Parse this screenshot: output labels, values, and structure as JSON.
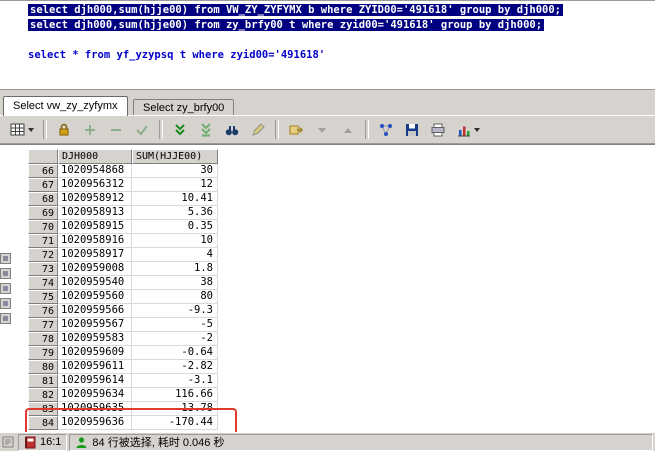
{
  "editor": {
    "lines": [
      {
        "text": "select djh000,sum(hjje00) from VW_ZY_ZYFYMX b where ZYID00='491618' group by djh000;",
        "selected": true
      },
      {
        "text": "select djh000,sum(hjje00) from zy_brfy00 t where zyid00='491618' group by djh000;",
        "selected": true
      },
      {
        "text": "select * from yf_yzypsq t where zyid00='491618'",
        "selected": false
      }
    ]
  },
  "tabs": [
    {
      "label": "Select vw_zy_zyfymx",
      "active": true
    },
    {
      "label": "Select zy_brfy00",
      "active": false
    }
  ],
  "toolbar": {
    "icons": [
      "result-grid-view",
      "lock",
      "insert-record",
      "delete-record",
      "post-changes",
      "fetch-next-page",
      "fetch-all",
      "find",
      "edit-data",
      "export-data",
      "sort-descending",
      "sort-ascending",
      "linked-query",
      "save-results",
      "print-results",
      "chart"
    ]
  },
  "grid": {
    "columns": [
      "DJH000",
      "SUM(HJJE00)"
    ],
    "rows": [
      [
        66,
        "1020954868",
        "30"
      ],
      [
        67,
        "1020956312",
        "12"
      ],
      [
        68,
        "1020958912",
        "10.41"
      ],
      [
        69,
        "1020958913",
        "5.36"
      ],
      [
        70,
        "1020958915",
        "0.35"
      ],
      [
        71,
        "1020958916",
        "10"
      ],
      [
        72,
        "1020958917",
        "4"
      ],
      [
        73,
        "1020959008",
        "1.8"
      ],
      [
        74,
        "1020959540",
        "38"
      ],
      [
        75,
        "1020959560",
        "80"
      ],
      [
        76,
        "1020959566",
        "-9.3"
      ],
      [
        77,
        "1020959567",
        "-5"
      ],
      [
        78,
        "1020959583",
        "-2"
      ],
      [
        79,
        "1020959609",
        "-0.64"
      ],
      [
        80,
        "1020959611",
        "-2.82"
      ],
      [
        81,
        "1020959614",
        "-3.1"
      ],
      [
        82,
        "1020959634",
        "116.66"
      ],
      [
        83,
        "1020959635",
        "13.78"
      ],
      [
        84,
        "1020959636",
        "-170.44"
      ]
    ],
    "annotation": {
      "rows": [
        83,
        84
      ],
      "color": "#e03a2e"
    }
  },
  "statusbar": {
    "position": "16:1",
    "message": "84 行被选择, 耗时 0.046 秒"
  },
  "colors": {
    "selection_background": "#000080",
    "sql_text": "#0000cc",
    "window_chrome": "#d6d3ce",
    "annotation_red": "#e03a2e"
  }
}
